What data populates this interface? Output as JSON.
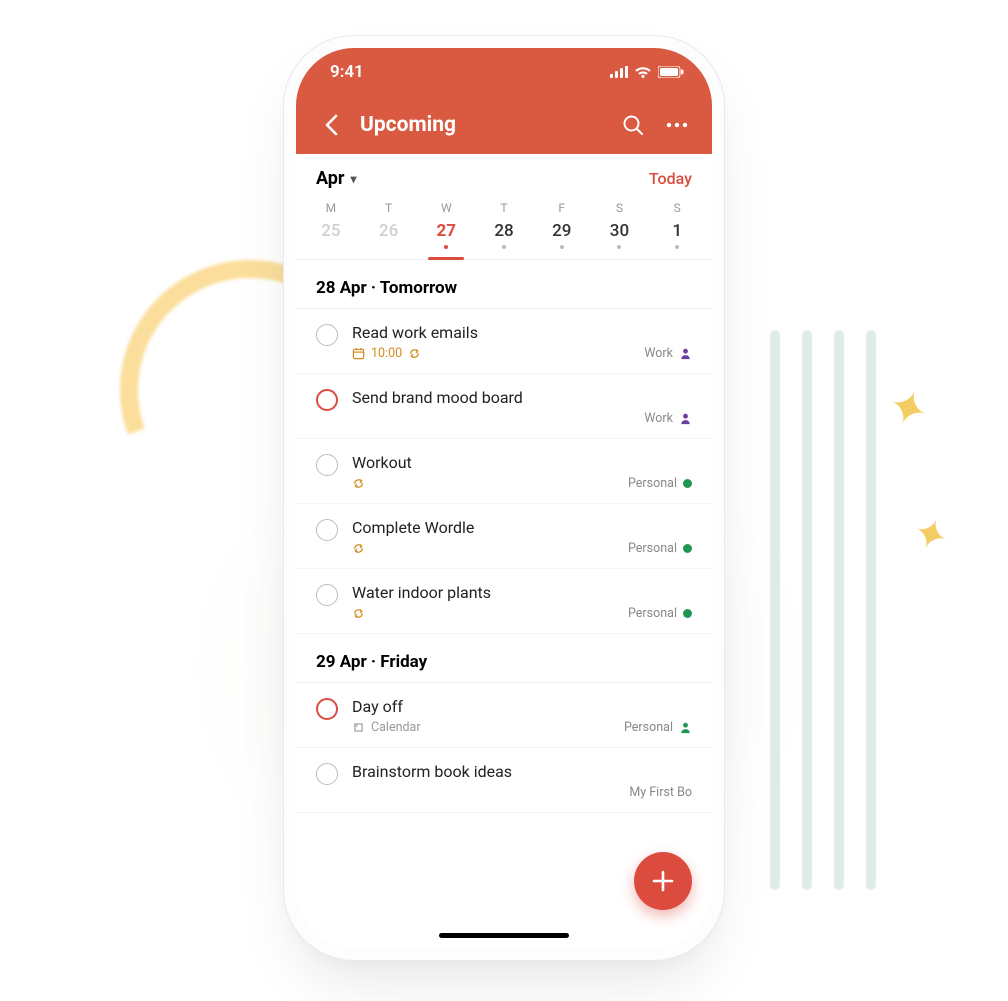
{
  "status": {
    "time": "9:41"
  },
  "header": {
    "title": "Upcoming"
  },
  "month_row": {
    "month_label": "Apr",
    "today_label": "Today"
  },
  "week": {
    "days": [
      {
        "dow": "M",
        "num": "25",
        "state": "past"
      },
      {
        "dow": "T",
        "num": "26",
        "state": "past"
      },
      {
        "dow": "W",
        "num": "27",
        "state": "today"
      },
      {
        "dow": "T",
        "num": "28",
        "state": "future"
      },
      {
        "dow": "F",
        "num": "29",
        "state": "future"
      },
      {
        "dow": "S",
        "num": "30",
        "state": "future"
      },
      {
        "dow": "S",
        "num": "1",
        "state": "future"
      }
    ]
  },
  "sections": [
    {
      "heading": "28 Apr · Tomorrow",
      "tasks": [
        {
          "title": "Read work emails",
          "priority": "normal",
          "time": "10:00",
          "recurring": true,
          "has_calendar_icon": true,
          "project": "Work",
          "project_color": "#6b3fa0",
          "project_icon": "person"
        },
        {
          "title": "Send brand mood board",
          "priority": "high",
          "recurring": false,
          "project": "Work",
          "project_color": "#6b3fa0",
          "project_icon": "person"
        },
        {
          "title": "Workout",
          "priority": "normal",
          "recurring": true,
          "project": "Personal",
          "project_color": "#209653",
          "project_icon": "dot"
        },
        {
          "title": "Complete Wordle",
          "priority": "normal",
          "recurring": true,
          "project": "Personal",
          "project_color": "#209653",
          "project_icon": "dot"
        },
        {
          "title": "Water indoor plants",
          "priority": "normal",
          "recurring": true,
          "project": "Personal",
          "project_color": "#209653",
          "project_icon": "dot"
        }
      ]
    },
    {
      "heading": "29 Apr · Friday",
      "tasks": [
        {
          "title": "Day off",
          "priority": "high",
          "recurring": false,
          "label": "Calendar",
          "project": "Personal",
          "project_color": "#209653",
          "project_icon": "person"
        },
        {
          "title": "Brainstorm book ideas",
          "priority": "normal",
          "recurring": false,
          "project": "My First Bo",
          "project_color": "#888888",
          "project_icon": "none"
        }
      ]
    }
  ],
  "colors": {
    "accent": "#db4c3f",
    "header_bg": "#d95a41",
    "amber": "#d38b1e"
  }
}
